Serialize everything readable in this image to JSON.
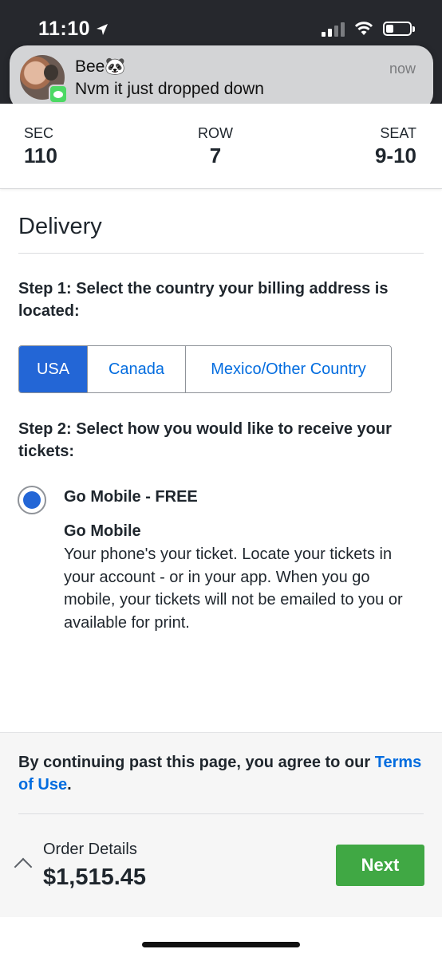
{
  "status_bar": {
    "time": "11:10",
    "location_icon": "location-arrow-icon",
    "signal_icon": "cellular-signal-icon",
    "wifi_icon": "wifi-icon",
    "battery_icon": "battery-low-icon"
  },
  "notification": {
    "sender": "Bee🐼",
    "message": "Nvm it just dropped down",
    "time": "now",
    "app_icon": "messages-icon"
  },
  "seat_info": {
    "sec_label": "SEC",
    "sec_value": "110",
    "row_label": "ROW",
    "row_value": "7",
    "seat_label": "SEAT",
    "seat_value": "9-10"
  },
  "delivery": {
    "title": "Delivery",
    "step1": "Step 1: Select the country your billing address is located:",
    "countries": [
      {
        "label": "USA",
        "selected": true
      },
      {
        "label": "Canada",
        "selected": false
      },
      {
        "label": "Mexico/Other Country",
        "selected": false
      }
    ],
    "step2": "Step 2: Select how you would like to receive your tickets:",
    "option": {
      "label": "Go Mobile - FREE",
      "selected": true,
      "heading": "Go Mobile",
      "description": "Your phone's your ticket. Locate your tickets in your account - or in your app. When you go mobile, your tickets will not be emailed to you or available for print."
    }
  },
  "footer": {
    "terms_prefix": "By continuing past this page, you agree to our ",
    "terms_link": "Terms of Use",
    "terms_suffix": ".",
    "order_label": "Order Details",
    "order_total": "$1,515.45",
    "next_label": "Next"
  },
  "colors": {
    "primary_blue": "#2366d6",
    "link_blue": "#026cdf",
    "next_green": "#40a844",
    "status_bar_bg": "#26282d"
  }
}
